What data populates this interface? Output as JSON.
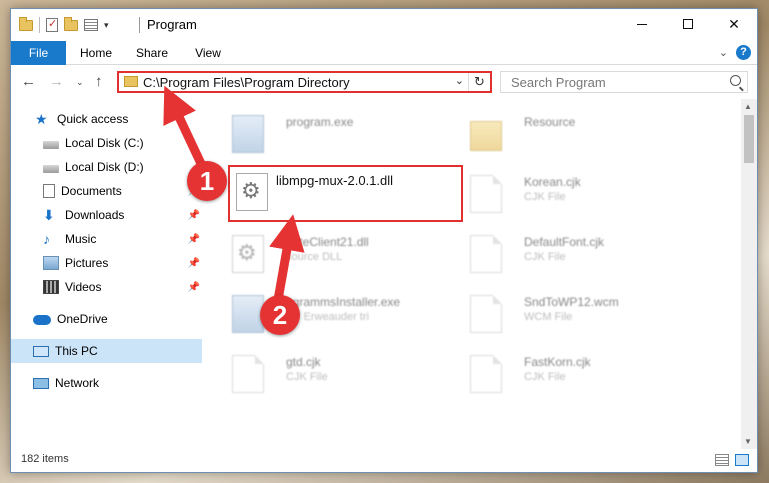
{
  "window": {
    "title": "Program",
    "minimize": "–",
    "close": "✕"
  },
  "ribbon": {
    "tabs": [
      "File",
      "Home",
      "Share",
      "View"
    ],
    "collapse": "⌄",
    "help": "?"
  },
  "address": {
    "path": "C:\\Program Files\\Program Directory",
    "dropdown": "⌄",
    "refresh": "↻"
  },
  "search": {
    "placeholder": "Search Program"
  },
  "nav": {
    "back": "←",
    "forward": "→",
    "recent": "⌄",
    "up": "↑"
  },
  "sidebar": {
    "items": [
      {
        "label": "Quick access",
        "icon": "star-icon"
      },
      {
        "label": "Local Disk (C:)",
        "icon": "disk-icon"
      },
      {
        "label": "Local Disk (D:)",
        "icon": "disk-icon"
      },
      {
        "label": "Documents",
        "icon": "documents-icon"
      },
      {
        "label": "Downloads",
        "icon": "download-icon"
      },
      {
        "label": "Music",
        "icon": "music-icon"
      },
      {
        "label": "Pictures",
        "icon": "pictures-icon"
      },
      {
        "label": "Videos",
        "icon": "videos-icon"
      },
      {
        "label": "OneDrive",
        "icon": "cloud-icon"
      },
      {
        "label": "This PC",
        "icon": "computer-icon"
      },
      {
        "label": "Network",
        "icon": "network-icon"
      }
    ],
    "pin": "📌"
  },
  "files": [
    {
      "name": "program.exe",
      "type": ""
    },
    {
      "name": "Resource",
      "type": ""
    },
    {
      "name": "Korean.cjk",
      "type": "CJK File"
    },
    {
      "name": "dateClient21.dll",
      "type": "source DLL"
    },
    {
      "name": "DefaultFont.cjk",
      "type": "CJK File"
    },
    {
      "name": "ogrammsInstaller.exe",
      "type": "BY Erweauder tri"
    },
    {
      "name": "SndToWP12.wcm",
      "type": "WCM File"
    },
    {
      "name": "gtd.cjk",
      "type": "CJK File"
    },
    {
      "name": "FastKorn.cjk",
      "type": "CJK File"
    }
  ],
  "highlighted_file": {
    "name": "libmpg-mux-2.0.1.dll"
  },
  "annotations": {
    "step1": "1",
    "step2": "2",
    "color": "#e03030"
  },
  "status": {
    "items_count": "182 items"
  },
  "colors": {
    "accent": "#1979ca",
    "selection": "#cce4f7",
    "annotation": "#e03030"
  }
}
